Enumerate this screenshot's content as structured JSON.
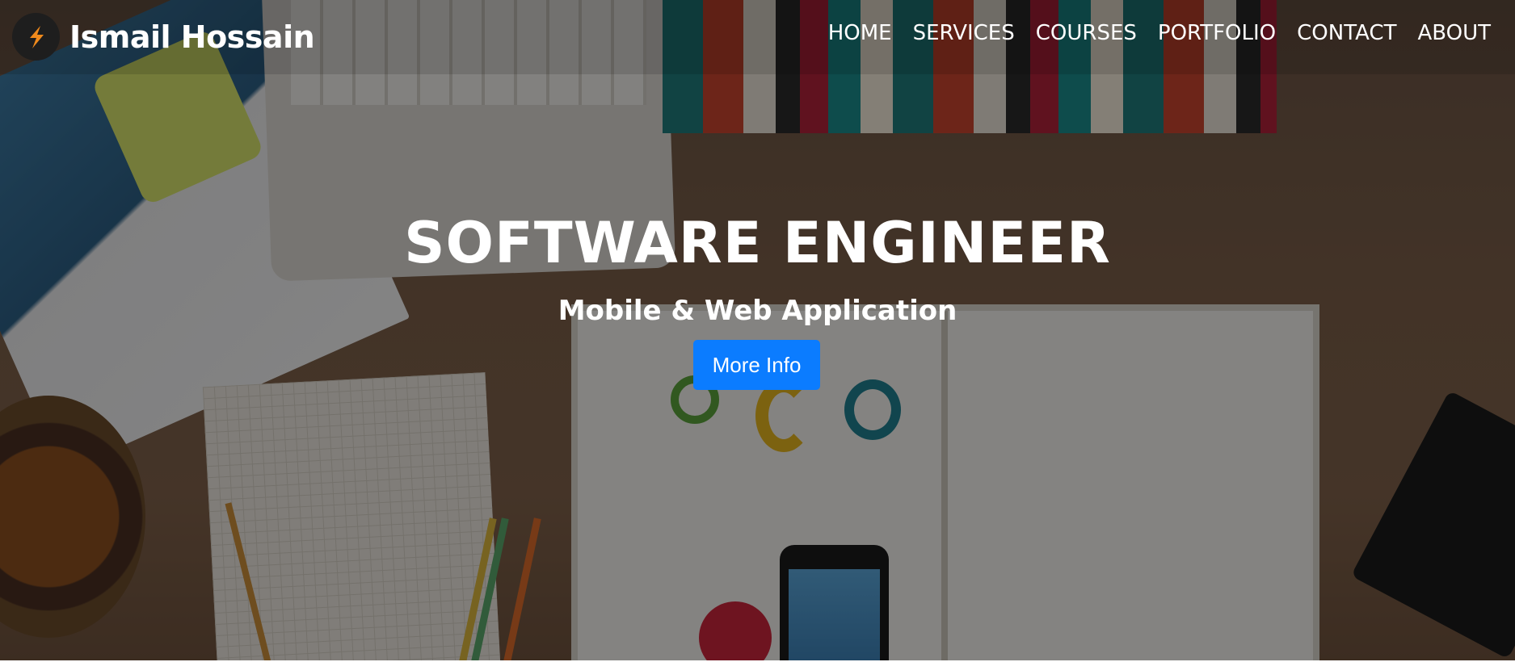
{
  "brand": {
    "name": "Ismail Hossain",
    "logo_icon": "lightning-s-logo-icon",
    "logo_color": "#f08a1c"
  },
  "nav": {
    "items": [
      {
        "label": "HOME"
      },
      {
        "label": "SERVICES"
      },
      {
        "label": "COURSES"
      },
      {
        "label": "PORTFOLIO"
      },
      {
        "label": "CONTACT"
      },
      {
        "label": "ABOUT"
      }
    ]
  },
  "hero": {
    "title": "SOFTWARE ENGINEER",
    "subtitle": "Mobile & Web Application",
    "button_label": "More Info",
    "button_color": "#0b7cff"
  }
}
